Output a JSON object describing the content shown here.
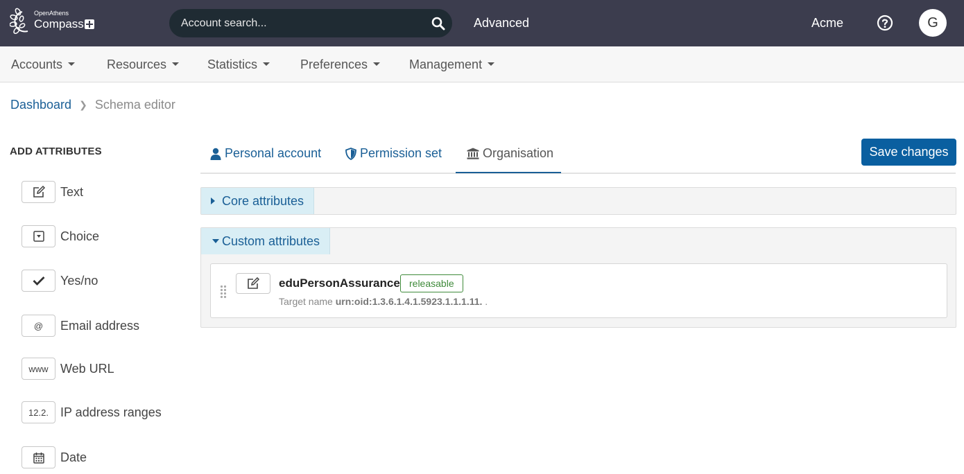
{
  "header": {
    "logo_small": "OpenAthens",
    "logo_big": "Compass",
    "search_placeholder": "Account search...",
    "advanced_label": "Advanced",
    "org_name": "Acme",
    "avatar_initial": "G"
  },
  "nav": {
    "items": [
      {
        "label": "Accounts"
      },
      {
        "label": "Resources"
      },
      {
        "label": "Statistics"
      },
      {
        "label": "Preferences"
      },
      {
        "label": "Management"
      }
    ]
  },
  "breadcrumb": {
    "home": "Dashboard",
    "current": "Schema editor"
  },
  "sidebar": {
    "title": "ADD ATTRIBUTES",
    "items": [
      {
        "label": "Text",
        "icon": "edit-icon"
      },
      {
        "label": "Choice",
        "icon": "dropdown-icon"
      },
      {
        "label": "Yes/no",
        "icon": "checkmark-icon"
      },
      {
        "label": "Email address",
        "icon_text": "@"
      },
      {
        "label": "Web URL",
        "icon_text": "www"
      },
      {
        "label": "IP address ranges",
        "icon_text": "12.2."
      },
      {
        "label": "Date",
        "icon": "calendar-icon"
      }
    ]
  },
  "tabs": {
    "items": [
      {
        "label": "Personal account",
        "icon": "user-icon"
      },
      {
        "label": "Permission set",
        "icon": "shield-icon"
      },
      {
        "label": "Organisation",
        "icon": "institution-icon"
      }
    ],
    "active": "Organisation"
  },
  "save_label": "Save changes",
  "panels": {
    "core": {
      "label": "Core attributes",
      "expanded": false
    },
    "custom": {
      "label": "Custom attributes",
      "expanded": true
    }
  },
  "custom_attribute": {
    "name": "eduPersonAssurance",
    "badge": "releasable",
    "target_prefix": "Target name",
    "target_value": "urn:oid:1.3.6.1.4.1.5923.1.1.1.11.",
    "target_suffix": " ."
  },
  "colors": {
    "topbar": "#3c3d4e",
    "link": "#1a5f96",
    "primary_button": "#0a5fa0",
    "badge": "#3f8a3a",
    "panel_header": "#d9eef5"
  }
}
